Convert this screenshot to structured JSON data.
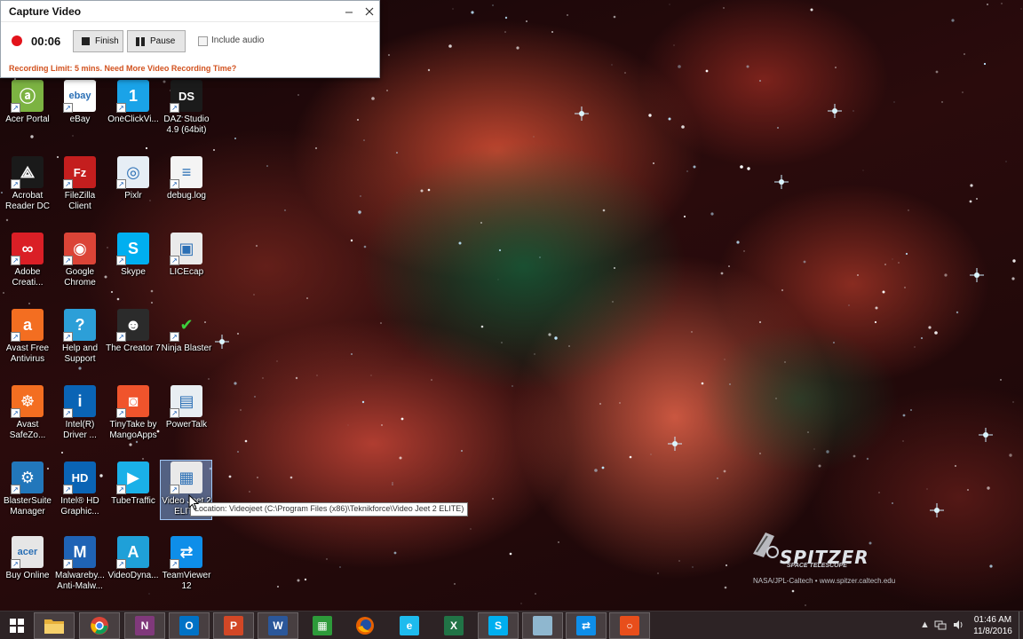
{
  "capture_window": {
    "title": "Capture Video",
    "timer": "00:06",
    "finish_label": "Finish",
    "pause_label": "Pause",
    "include_audio_label": "Include audio",
    "include_audio_checked": false,
    "recording_limit": "Recording Limit: 5 mins. Need More Video Recording Time?",
    "accent_color": "#d2521f"
  },
  "desktop_icons": [
    {
      "label": "Acer Portal",
      "icon": "acer-portal-icon"
    },
    {
      "label": "eBay",
      "icon": "ebay-icon"
    },
    {
      "label": "OneClickVi...",
      "icon": "oneclickvideo-icon"
    },
    {
      "label": "DAZ Studio 4.9 (64bit)",
      "icon": "daz-studio-icon"
    },
    {
      "label": "Acrobat Reader DC",
      "icon": "acrobat-icon"
    },
    {
      "label": "FileZilla Client",
      "icon": "filezilla-icon"
    },
    {
      "label": "Pixlr",
      "icon": "pixlr-icon"
    },
    {
      "label": "debug.log",
      "icon": "text-file-icon"
    },
    {
      "label": "Adobe Creati...",
      "icon": "adobe-cc-icon"
    },
    {
      "label": "Google Chrome",
      "icon": "chrome-icon"
    },
    {
      "label": "Skype",
      "icon": "skype-icon"
    },
    {
      "label": "LICEcap",
      "icon": "licecap-icon"
    },
    {
      "label": "Avast Free Antivirus",
      "icon": "avast-icon"
    },
    {
      "label": "Help and Support",
      "icon": "help-icon"
    },
    {
      "label": "The Creator 7",
      "icon": "creator-icon"
    },
    {
      "label": "Ninja Blaster",
      "icon": "ninja-blaster-icon"
    },
    {
      "label": "Avast SafeZo...",
      "icon": "avast-safezone-icon"
    },
    {
      "label": "Intel(R) Driver ...",
      "icon": "intel-driver-icon"
    },
    {
      "label": "TinyTake by MangoApps",
      "icon": "tinytake-icon"
    },
    {
      "label": "PowerTalk",
      "icon": "powertalk-icon"
    },
    {
      "label": "BlasterSuite Manager",
      "icon": "blastersuite-icon"
    },
    {
      "label": "Intel® HD Graphic...",
      "icon": "intel-hd-icon"
    },
    {
      "label": "TubeTraffic",
      "icon": "tubetraffic-icon"
    },
    {
      "label": "Video Jeet 2 ELITE",
      "icon": "videojeet-icon"
    },
    {
      "label": "Buy Online",
      "icon": "buy-online-icon"
    },
    {
      "label": "Malwareby... Anti-Malw...",
      "icon": "malwarebytes-icon"
    },
    {
      "label": "VideoDyna...",
      "icon": "videodyna-icon"
    },
    {
      "label": "TeamViewer 12",
      "icon": "teamviewer-icon"
    }
  ],
  "tooltip": "Location: Videojeet (C:\\Program Files (x86)\\Teknikforce\\Video Jeet 2 ELITE)",
  "wallpaper": {
    "logo": "SPITZER",
    "logo_sub": "SPACE TELESCOPE",
    "credit": "NASA/JPL-Caltech • www.spitzer.caltech.edu"
  },
  "taskbar": {
    "apps": [
      {
        "name": "start-button",
        "color": "#ffffff",
        "glyph": "⊞"
      },
      {
        "name": "file-explorer",
        "color": "#e8b13a",
        "glyph": ""
      },
      {
        "name": "chrome",
        "color": "#dd4b39",
        "glyph": ""
      },
      {
        "name": "onenote",
        "color": "#80397b",
        "glyph": "N"
      },
      {
        "name": "outlook",
        "color": "#0072c6",
        "glyph": "O"
      },
      {
        "name": "powerpoint",
        "color": "#d24726",
        "glyph": "P"
      },
      {
        "name": "word",
        "color": "#2b579a",
        "glyph": "W"
      },
      {
        "name": "store",
        "color": "#2d9a3a",
        "glyph": "▦"
      },
      {
        "name": "firefox",
        "color": "#e66000",
        "glyph": ""
      },
      {
        "name": "internet-explorer",
        "color": "#1ebbee",
        "glyph": "e"
      },
      {
        "name": "excel",
        "color": "#217346",
        "glyph": "X"
      },
      {
        "name": "skype",
        "color": "#00aff0",
        "glyph": "S"
      },
      {
        "name": "app-window",
        "color": "#8fb7cf",
        "glyph": ""
      },
      {
        "name": "teamviewer",
        "color": "#0e8ee9",
        "glyph": "⇄"
      },
      {
        "name": "recorder",
        "color": "#e84e1b",
        "glyph": "○"
      }
    ],
    "time": "01:46 AM",
    "date": "11/8/2016"
  }
}
